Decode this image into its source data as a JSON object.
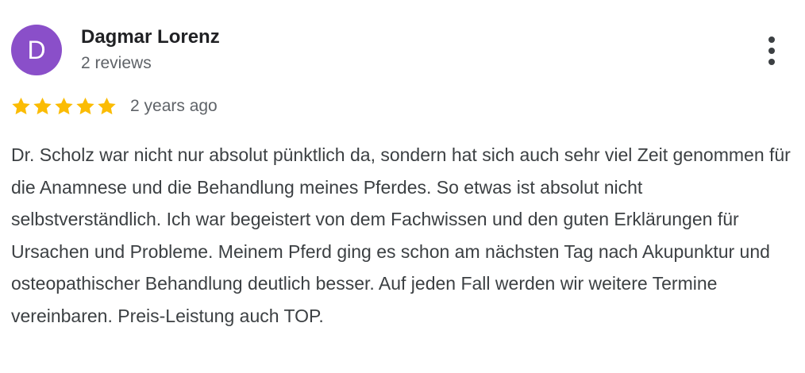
{
  "author": {
    "initial": "D",
    "name": "Dagmar Lorenz",
    "reviews": "2 reviews",
    "avatar_color": "#8a4fc9"
  },
  "menu": {
    "icon": "more-vert-icon"
  },
  "rating": {
    "stars": 5,
    "max": 5,
    "star_color": "#fbbc04",
    "date": "2 years ago"
  },
  "review": {
    "text": "Dr. Scholz war nicht nur absolut pünktlich da, sondern hat sich auch sehr viel Zeit genommen für die Anamnese und die Behandlung meines Pferdes. So etwas ist absolut nicht selbstverständlich. Ich war begeistert von dem Fachwissen und den guten Erklärungen für Ursachen und Probleme. Meinem Pferd ging es schon am nächsten Tag nach Akupunktur und osteopathischer Behandlung deutlich besser. Auf jeden Fall werden wir weitere Termine vereinbaren. Preis-Leistung auch TOP."
  }
}
